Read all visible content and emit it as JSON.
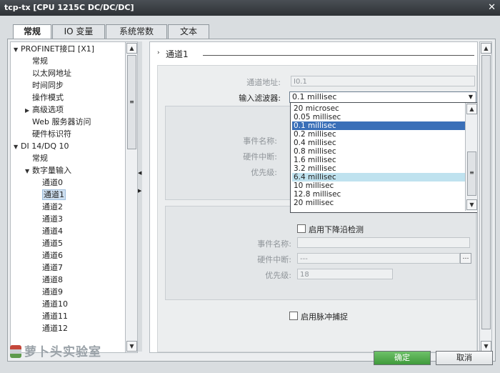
{
  "window": {
    "title": "tcp-tx [CPU 1215C DC/DC/DC]"
  },
  "tabs": [
    {
      "label": "常规",
      "active": true
    },
    {
      "label": "IO 变量",
      "active": false
    },
    {
      "label": "系统常数",
      "active": false
    },
    {
      "label": "文本",
      "active": false
    }
  ],
  "tree": {
    "items": [
      {
        "label": "PROFINET接口 [X1]",
        "arrow": "▼"
      },
      {
        "label": "常规"
      },
      {
        "label": "以太网地址"
      },
      {
        "label": "时间同步"
      },
      {
        "label": "操作模式"
      },
      {
        "label": "高级选项",
        "arrow": "▶"
      },
      {
        "label": "Web 服务器访问"
      },
      {
        "label": "硬件标识符"
      },
      {
        "label": "DI 14/DQ 10",
        "arrow": "▼"
      },
      {
        "label": "常规"
      },
      {
        "label": "数字量输入",
        "arrow": "▼"
      },
      {
        "label": "通道0"
      },
      {
        "label": "通道1",
        "selected": true
      },
      {
        "label": "通道2"
      },
      {
        "label": "通道3"
      },
      {
        "label": "通道4"
      },
      {
        "label": "通道5"
      },
      {
        "label": "通道6"
      },
      {
        "label": "通道7"
      },
      {
        "label": "通道8"
      },
      {
        "label": "通道9"
      },
      {
        "label": "通道10"
      },
      {
        "label": "通道11"
      },
      {
        "label": "通道12"
      }
    ]
  },
  "content": {
    "section_title": "通道1",
    "channel_address_label": "通道地址:",
    "channel_address_value": "I0.1",
    "input_filter_label": "输入滤波器:",
    "input_filter_value": "0.1 millisec",
    "filter_options": [
      {
        "label": "20 microsec"
      },
      {
        "label": "0.05 millisec"
      },
      {
        "label": "0.1 millisec",
        "selected": true
      },
      {
        "label": "0.2 millisec"
      },
      {
        "label": "0.4 millisec"
      },
      {
        "label": "0.8 millisec"
      },
      {
        "label": "1.6 millisec"
      },
      {
        "label": "3.2 millisec"
      },
      {
        "label": "6.4 millisec",
        "hover": true
      },
      {
        "label": "10 millisec"
      },
      {
        "label": "12.8 millisec"
      },
      {
        "label": "20 millisec"
      }
    ],
    "rising": {
      "event_name_label": "事件名称:",
      "hw_interrupt_label": "硬件中断:",
      "priority_label": "优先级:"
    },
    "falling": {
      "checkbox_label": "启用下降沿检测",
      "event_name_label": "事件名称:",
      "hw_interrupt_label": "硬件中断:",
      "hw_interrupt_value": "---",
      "priority_label": "优先级:",
      "priority_value": "18"
    },
    "pulse_checkbox_label": "启用脉冲捕捉"
  },
  "footer": {
    "watermark": "萝卜头实验室",
    "ok_label": "确定",
    "cancel_label": "取消"
  },
  "colors": {
    "ok_button": "#4fae4a",
    "selected_option": "#3a6fb8",
    "hover_option": "#bfe2ef"
  }
}
